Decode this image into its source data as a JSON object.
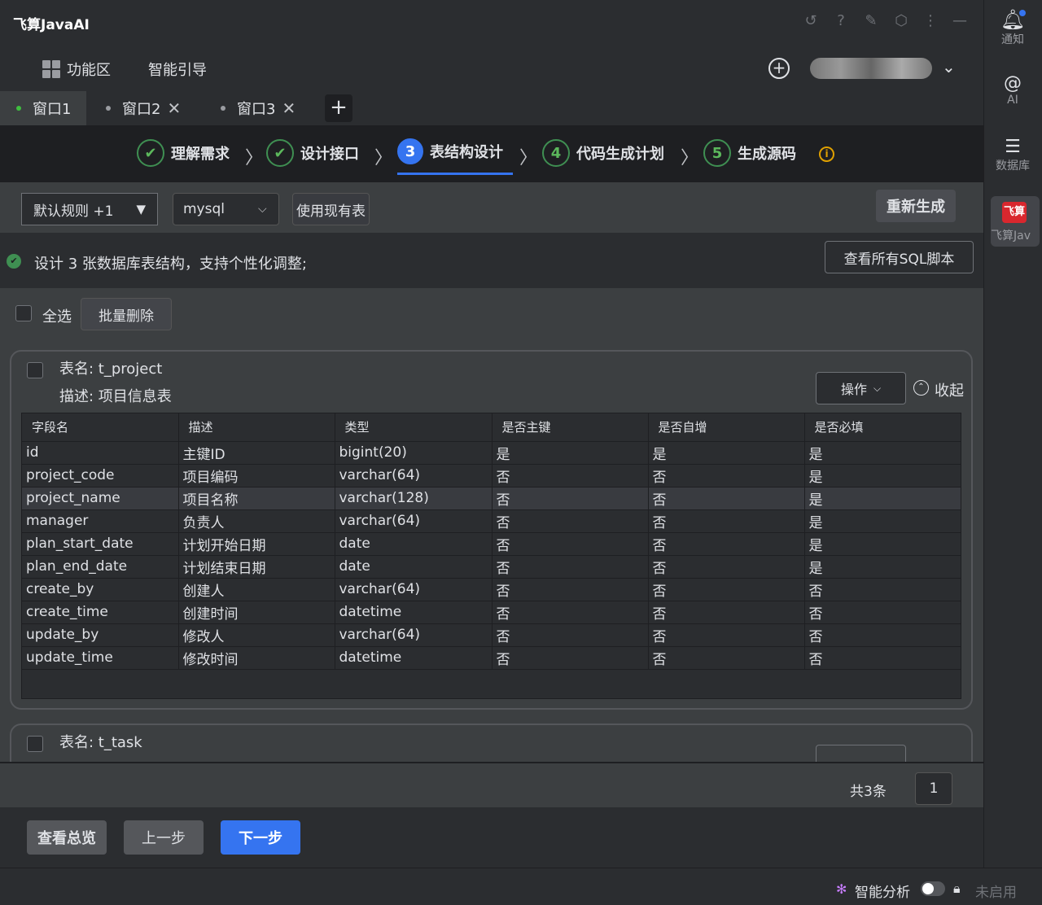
{
  "app": {
    "title": "飞算JavaAI"
  },
  "menu": {
    "area": "功能区",
    "guide": "智能引导",
    "plus": "+"
  },
  "tabs": [
    {
      "label": "窗口1",
      "close": ""
    },
    {
      "label": "窗口2",
      "close": "✕"
    },
    {
      "label": "窗口3",
      "close": "✕"
    }
  ],
  "tab_add": "+",
  "steps": [
    {
      "num": "✔",
      "label": "理解需求"
    },
    {
      "num": "✔",
      "label": "设计接口"
    },
    {
      "num": "3",
      "label": "表结构设计"
    },
    {
      "num": "4",
      "label": "代码生成计划"
    },
    {
      "num": "5",
      "label": "生成源码"
    }
  ],
  "toolbar": {
    "rule_select": "默认规则 +1",
    "rule_arrow": "▼",
    "db_select": "mysql",
    "db_arrow": "⌵",
    "use_existing": "使用现有表",
    "regenerate": "重新生成"
  },
  "info": {
    "text": "设计 3 张数据库表结构，支持个性化调整;",
    "view_sql": "查看所有SQL脚本"
  },
  "bulk": {
    "select_all": "全选",
    "batch_delete": "批量删除"
  },
  "table1": {
    "name": "表名: t_project",
    "desc": "描述: 项目信息表",
    "action": "操作",
    "action_arrow": "⌵",
    "collapse": "收起",
    "columns": [
      "字段名",
      "描述",
      "类型",
      "是否主键",
      "是否自增",
      "是否必填"
    ],
    "rows": [
      [
        "id",
        "主键ID",
        "bigint(20)",
        "是",
        "是",
        "是"
      ],
      [
        "project_code",
        "项目编码",
        "varchar(64)",
        "否",
        "否",
        "是"
      ],
      [
        "project_name",
        "项目名称",
        "varchar(128)",
        "否",
        "否",
        "是"
      ],
      [
        "manager",
        "负责人",
        "varchar(64)",
        "否",
        "否",
        "是"
      ],
      [
        "plan_start_date",
        "计划开始日期",
        "date",
        "否",
        "否",
        "是"
      ],
      [
        "plan_end_date",
        "计划结束日期",
        "date",
        "否",
        "否",
        "是"
      ],
      [
        "create_by",
        "创建人",
        "varchar(64)",
        "否",
        "否",
        "否"
      ],
      [
        "create_time",
        "创建时间",
        "datetime",
        "否",
        "否",
        "否"
      ],
      [
        "update_by",
        "修改人",
        "varchar(64)",
        "否",
        "否",
        "否"
      ],
      [
        "update_time",
        "修改时间",
        "datetime",
        "否",
        "否",
        "否"
      ]
    ]
  },
  "table2": {
    "name": "表名: t_task"
  },
  "pager": {
    "total": "共3条",
    "page": "1"
  },
  "footer": {
    "overview": "查看总览",
    "prev": "上一步",
    "next": "下一步"
  },
  "rail": {
    "notify": "通知",
    "ai": "AI",
    "database": "数据库",
    "feisuan": "飞算Jav",
    "feisuan_logo": "飞算"
  },
  "status": {
    "analysis": "智能分析",
    "disabled": "未启用"
  },
  "colors": {
    "accent": "#3574f0",
    "success": "#5cb85c",
    "warning": "#e0a000",
    "brand": "#d9272e"
  }
}
